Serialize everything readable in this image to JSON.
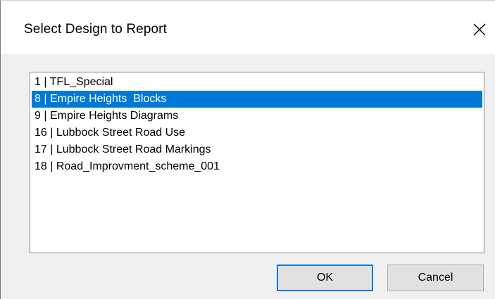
{
  "dialog": {
    "title": "Select Design to Report"
  },
  "designs": [
    {
      "label": "1 | TFL_Special",
      "selected": false
    },
    {
      "label": "8 | Empire Heights  Blocks",
      "selected": true
    },
    {
      "label": "9 | Empire Heights Diagrams",
      "selected": false
    },
    {
      "label": "16 | Lubbock Street Road Use",
      "selected": false
    },
    {
      "label": "17 | Lubbock Street Road Markings",
      "selected": false
    },
    {
      "label": "18 | Road_Improvment_scheme_001",
      "selected": false
    }
  ],
  "buttons": {
    "ok_label": "OK",
    "cancel_label": "Cancel"
  },
  "colors": {
    "selection": "#0078d7",
    "default_button_border": "#0078d7",
    "dialog_background": "#f0f0f0"
  },
  "icons": {
    "close": "close-icon"
  }
}
